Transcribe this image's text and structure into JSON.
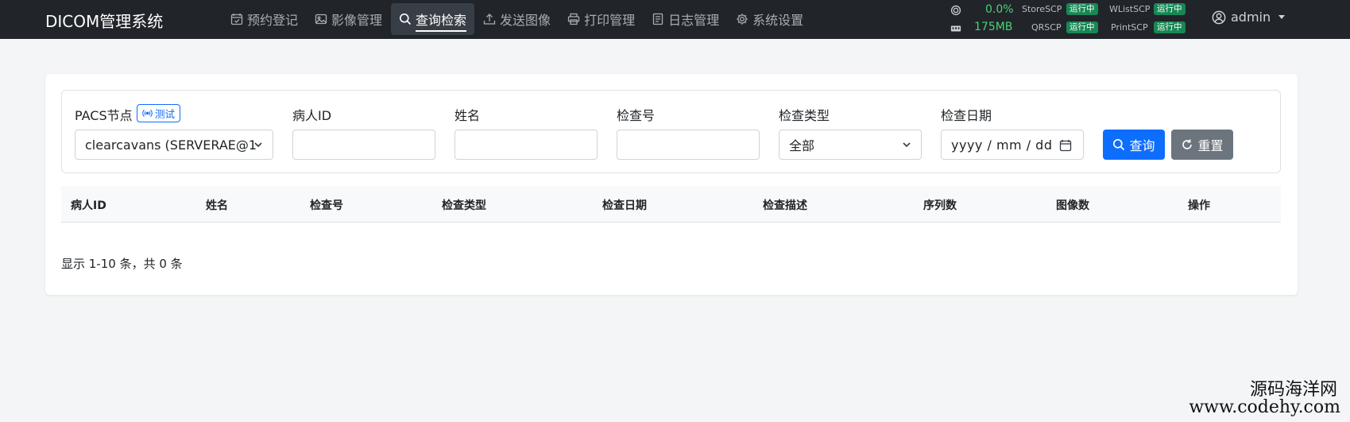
{
  "app": {
    "title": "DICOM管理系统"
  },
  "nav": {
    "items": [
      {
        "label": "预约登记",
        "icon": "calendar-check-icon",
        "active": false
      },
      {
        "label": "影像管理",
        "icon": "image-icon",
        "active": false
      },
      {
        "label": "查询检索",
        "icon": "search-icon",
        "active": true
      },
      {
        "label": "发送图像",
        "icon": "upload-icon",
        "active": false
      },
      {
        "label": "打印管理",
        "icon": "printer-icon",
        "active": false
      },
      {
        "label": "日志管理",
        "icon": "document-icon",
        "active": false
      },
      {
        "label": "系统设置",
        "icon": "gear-icon",
        "active": false
      }
    ]
  },
  "status": {
    "cpu": "0.0%",
    "memory": "175MB",
    "services": [
      {
        "name": "StoreSCP",
        "state": "运行中"
      },
      {
        "name": "WListSCP",
        "state": "运行中"
      },
      {
        "name": "QRSCP",
        "state": "运行中"
      },
      {
        "name": "PrintSCP",
        "state": "运行中"
      }
    ],
    "running_color": "#198754"
  },
  "user": {
    "name": "admin"
  },
  "filters": {
    "pacs_label": "PACS节点",
    "test_label": "测试",
    "pacs_value": "clearcavans (SERVERAE@1",
    "patient_id_label": "病人ID",
    "patient_id_value": "",
    "name_label": "姓名",
    "name_value": "",
    "exam_no_label": "检查号",
    "exam_no_value": "",
    "exam_type_label": "检查类型",
    "exam_type_value": "全部",
    "exam_date_label": "检查日期",
    "exam_date_placeholder": "yyyy / mm / dd",
    "search_label": "查询",
    "reset_label": "重置"
  },
  "table": {
    "columns": [
      "病人ID",
      "姓名",
      "检查号",
      "检查类型",
      "检查日期",
      "检查描述",
      "序列数",
      "图像数",
      "操作"
    ],
    "rows": []
  },
  "summary": "显示 1-10 条，共 0 条",
  "watermark": {
    "line1": "源码海洋网",
    "line2": "www.codehy.com"
  },
  "colors": {
    "primary": "#0d6efd",
    "secondary": "#6c757d",
    "navbar": "#212529"
  }
}
